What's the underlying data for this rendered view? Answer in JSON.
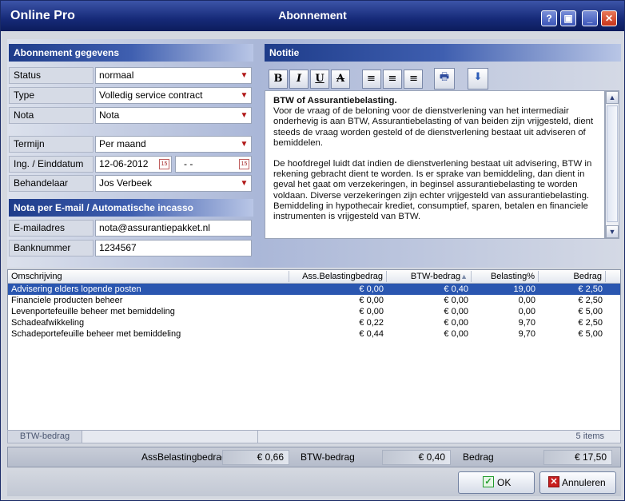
{
  "titlebar": {
    "app_name": "Online Pro",
    "window_title": "Abonnement",
    "help_glyph": "?",
    "restore_glyph": "▣",
    "minimize_glyph": "_",
    "close_glyph": "✕"
  },
  "subscription": {
    "heading": "Abonnement gegevens",
    "fields": [
      {
        "label": "Status",
        "value": "normaal",
        "control": "dropdown"
      },
      {
        "label": "Type",
        "value": "Volledig service contract",
        "control": "dropdown"
      },
      {
        "label": "Nota",
        "value": "Nota",
        "control": "dropdown"
      },
      {
        "label": "Termijn",
        "value": "Per maand",
        "control": "dropdown"
      },
      {
        "label": "Ing. / Einddatum",
        "value": "12-06-2012",
        "end_value": "-  -",
        "control": "date-range"
      },
      {
        "label": "Behandelaar",
        "value": "Jos Verbeek",
        "control": "dropdown"
      }
    ]
  },
  "email_section": {
    "heading": "Nota per E-mail / Automatische incasso",
    "email_label": "E-mailadres",
    "email_value": "nota@assurantiepakket.nl",
    "bank_label": "Banknummer",
    "bank_value": "1234567"
  },
  "notes": {
    "heading": "Notitie",
    "toolbar": {
      "bold": "B",
      "italic": "I",
      "underline": "U",
      "strike": "A",
      "align_left": "≡",
      "align_center": "≡",
      "align_right": "≡",
      "print": "🖶",
      "download": "⬇"
    },
    "title": "BTW of Assurantiebelasting.",
    "paragraph1": "Voor de vraag of de beloning voor de dienstverlening van het intermediair onderhevig is aan BTW, Assurantiebelasting of van beiden zijn vrijgesteld, dient steeds de vraag worden gesteld of de dienstverlening bestaat uit adviseren of bemiddelen.",
    "paragraph2": "De hoofdregel luidt dat indien de dienstverlening bestaat uit advisering, BTW in rekening gebracht dient te worden. Is er sprake van bemiddeling, dan dient in geval het gaat om verzekeringen, in beginsel assurantiebelasting te worden voldaan. Diverse verzekeringen zijn echter vrijgesteld van assurantiebelasting. Bemiddeling in hypothecair krediet, consumptief, sparen, betalen en financiele instrumenten is vrijgesteld van BTW.",
    "scroll_up": "▲",
    "scroll_down": "▼"
  },
  "grid": {
    "columns": [
      "Omschrijving",
      "Ass.Belastingbedrag",
      "BTW-bedrag",
      "Belasting%",
      "Bedrag"
    ],
    "sort_indicator": "▲",
    "rows": [
      {
        "desc": "Advisering elders lopende posten",
        "ass": "€ 0,00",
        "btw": "€ 0,40",
        "pct": "19,00",
        "amount": "€ 2,50",
        "selected": true
      },
      {
        "desc": "Financiele producten beheer",
        "ass": "€ 0,00",
        "btw": "€ 0,00",
        "pct": "0,00",
        "amount": "€ 2,50",
        "selected": false
      },
      {
        "desc": "Levenportefeuille beheer met bemiddeling",
        "ass": "€ 0,00",
        "btw": "€ 0,00",
        "pct": "0,00",
        "amount": "€ 5,00",
        "selected": false
      },
      {
        "desc": "Schadeafwikkeling",
        "ass": "€ 0,22",
        "btw": "€ 0,00",
        "pct": "9,70",
        "amount": "€ 2,50",
        "selected": false
      },
      {
        "desc": "Schadeportefeuille beheer met bemiddeling",
        "ass": "€ 0,44",
        "btw": "€ 0,00",
        "pct": "9,70",
        "amount": "€ 5,00",
        "selected": false
      }
    ],
    "footer_label": "BTW-bedrag",
    "footer_count": "5 items"
  },
  "totals": {
    "ass_label": "AssBelastingbedrag",
    "ass_value": "€ 0,66",
    "btw_label": "BTW-bedrag",
    "btw_value": "€ 0,40",
    "amount_label": "Bedrag",
    "amount_value": "€ 17,50"
  },
  "buttons": {
    "ok": "OK",
    "ok_icon": "✓",
    "cancel": "Annuleren",
    "cancel_icon": "✕"
  },
  "colors": {
    "title_bar": "#162a78",
    "selection": "#2a56b0",
    "dropdown_arrow": "#b01818",
    "ok_icon": "#1f9a2a",
    "cancel_icon": "#c81e1e"
  }
}
